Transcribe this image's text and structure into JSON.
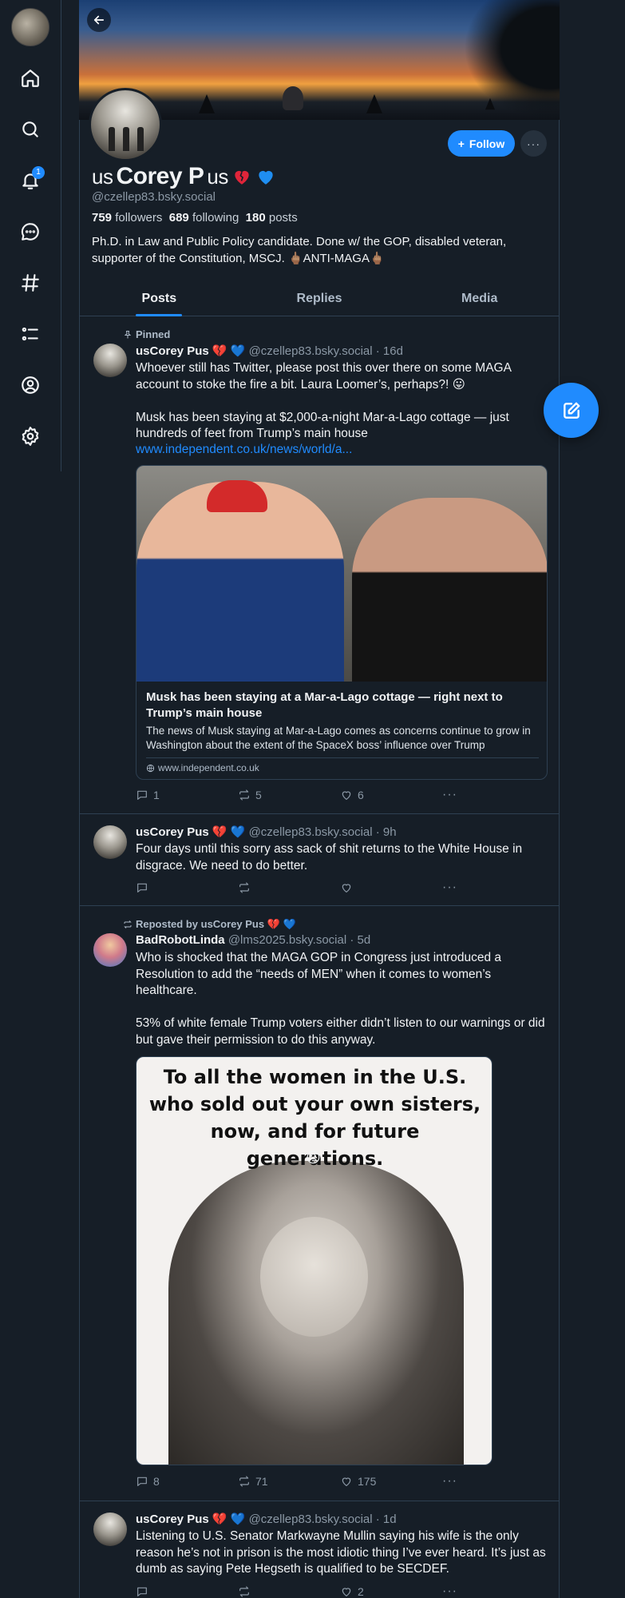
{
  "nav": {
    "notifications_badge": "1",
    "items": [
      "home-icon",
      "search-icon",
      "bell-icon",
      "chat-icon",
      "hashtag-icon",
      "list-icon",
      "profile-icon",
      "settings-icon"
    ]
  },
  "profile": {
    "name_prefix": "us",
    "name_main": "Corey P",
    "name_suffix": "us",
    "handle": "@czellep83.bsky.social",
    "followers_count": "759",
    "followers_label": "followers",
    "following_count": "689",
    "following_label": "following",
    "posts_count": "180",
    "posts_label": "posts",
    "bio": "Ph.D. in Law and Public Policy candidate. Done w/ the GOP, disabled veteran, supporter of the Constitution, MSCJ. 🖕🏽ANTI-MAGA🖕🏽",
    "follow_label": "Follow",
    "more_label": "···"
  },
  "tabs": [
    {
      "label": "Posts",
      "active": true
    },
    {
      "label": "Replies",
      "active": false
    },
    {
      "label": "Media",
      "active": false
    }
  ],
  "posts": [
    {
      "context": "Pinned",
      "author": "usCorey Pus 💔 💙",
      "handle": "@czellep83.bsky.social",
      "time": "· 16d",
      "text": "Whoever still has Twitter, please post this over there on some MAGA account to stoke the fire a bit. Laura Loomer’s, perhaps?! 😛\n\nMusk has been staying at $2,000-a-night Mar-a-Lago cottage — just hundreds of feet from Trump’s main house",
      "link": "www.independent.co.uk/news/world/a...",
      "card": {
        "title": "Musk has been staying at a Mar-a-Lago cottage — right next to Trump’s main house",
        "description": "The news of Musk staying at Mar-a-Lago comes as concerns continue to grow in Washington about the extent of the SpaceX boss’ influence over Trump",
        "domain": "www.independent.co.uk"
      },
      "replies": "1",
      "reposts": "5",
      "likes": "6"
    },
    {
      "author": "usCorey Pus 💔 💙",
      "handle": "@czellep83.bsky.social",
      "time": "· 9h",
      "text": "Four days until this sorry ass sack of shit returns to the White House in disgrace. We need to do better.",
      "replies": "",
      "reposts": "",
      "likes": ""
    },
    {
      "context": "Reposted by usCorey Pus 💔 💙",
      "author": "BadRobotLinda",
      "handle": "@lms2025.bsky.social",
      "time": "· 5d",
      "text": "Who is shocked that the MAGA GOP in Congress just introduced a Resolution to add the “needs of MEN” when it comes to women’s healthcare.\n\n53% of white female Trump voters either didn’t listen to our warnings or did but gave their permission to do this anyway.",
      "meme_caption": "To all the women in the U.S. who sold out your own sisters, now, and for future generations.",
      "replies": "8",
      "reposts": "71",
      "likes": "175"
    },
    {
      "author": "usCorey Pus 💔 💙",
      "handle": "@czellep83.bsky.social",
      "time": "· 1d",
      "text": "Listening to U.S. Senator Markwayne Mullin saying his wife is the only reason he’s not in prison is the most idiotic thing I’ve ever heard. It’s just as dumb as saying Pete Hegseth is qualified to be SECDEF.",
      "replies": "",
      "reposts": "",
      "likes": "2"
    }
  ],
  "colors": {
    "background": "#161e27",
    "accent": "#208bfe",
    "border": "#2e4052",
    "muted": "#8b98a5"
  }
}
